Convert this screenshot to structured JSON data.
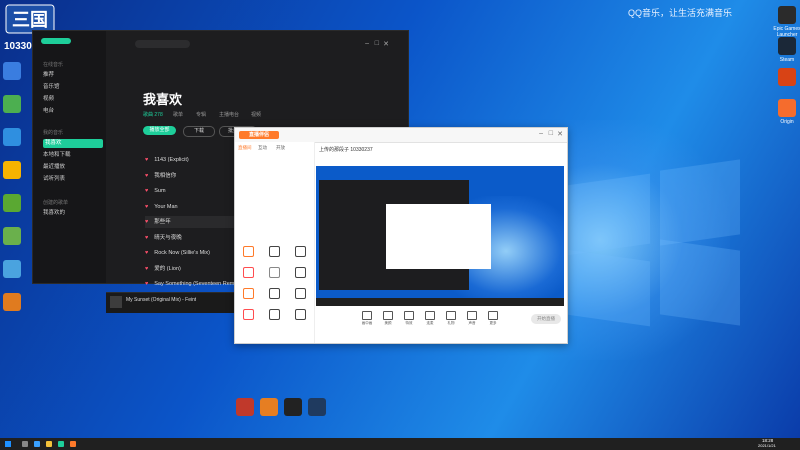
{
  "overlay": {
    "top_right_text": "QQ音乐，让生活充满音乐",
    "account_id": "10330237"
  },
  "desktop_icons_left": [
    {
      "label": "",
      "color": "#3a7de0"
    },
    {
      "label": "",
      "color": "#4caf50"
    },
    {
      "label": "",
      "color": "#2f8fe0"
    },
    {
      "label": "",
      "color": "#f6b300"
    },
    {
      "label": "",
      "color": "#5aa832"
    },
    {
      "label": "",
      "color": "#6ab04c"
    },
    {
      "label": "",
      "color": "#4aa3df"
    },
    {
      "label": "",
      "color": "#e07b1f"
    }
  ],
  "desktop_icons_right": [
    {
      "label": "Epic Games Launcher",
      "color": "#2b2b2b"
    },
    {
      "label": "Steam",
      "color": "#1b2838"
    },
    {
      "label": "",
      "color": "#d84315"
    },
    {
      "label": "Origin",
      "color": "#f56c2d"
    }
  ],
  "desktop_icons_bottom": [
    {
      "label": "",
      "color": "#c0392b"
    },
    {
      "label": "",
      "color": "#e67e22"
    },
    {
      "label": "",
      "color": "#222222"
    },
    {
      "label": "",
      "color": "#1f3a5f"
    }
  ],
  "music_app": {
    "sidebar_sections": [
      "在线音乐",
      "我的音乐",
      "创建的歌单"
    ],
    "sidebar_items_online": [
      "推荐",
      "音乐馆",
      "视频",
      "电台"
    ],
    "sidebar_items_mine": [
      "我喜欢",
      "本地和下载",
      "最近播放",
      "试听列表"
    ],
    "sidebar_items_playlists": [
      "我喜欢的",
      ""
    ],
    "page_title": "我喜欢",
    "tabs": [
      "歌曲 278",
      "歌单",
      "专辑",
      "主播电台",
      "视频"
    ],
    "play_all": "播放全部",
    "download": "下载",
    "batch": "批量操作",
    "songs": [
      {
        "title": "1143 (Explicit)"
      },
      {
        "title": "我相信你"
      },
      {
        "title": "Sum"
      },
      {
        "title": "Your Man"
      },
      {
        "title": "那些年"
      },
      {
        "title": "晴天与夜晚"
      },
      {
        "title": "Rock Now (Sillie's Mix)"
      },
      {
        "title": "爱的 (Lion)"
      },
      {
        "title": "Say Something (Seventeen Remix)"
      }
    ],
    "now_playing": "My Sunset (Original Mix) - Feint"
  },
  "live_app": {
    "logo_text": "直播伴侣",
    "tabs": [
      "直播间",
      "互动",
      "开放"
    ],
    "room_title": "上传的那段子 10330237",
    "tools": [
      "画中画",
      "美颜",
      "特效",
      "连麦",
      "礼物",
      "声音",
      "更多"
    ],
    "start_button": "开始直播"
  },
  "taskbar": {
    "time": "18:28",
    "date": "2021/1/21"
  }
}
